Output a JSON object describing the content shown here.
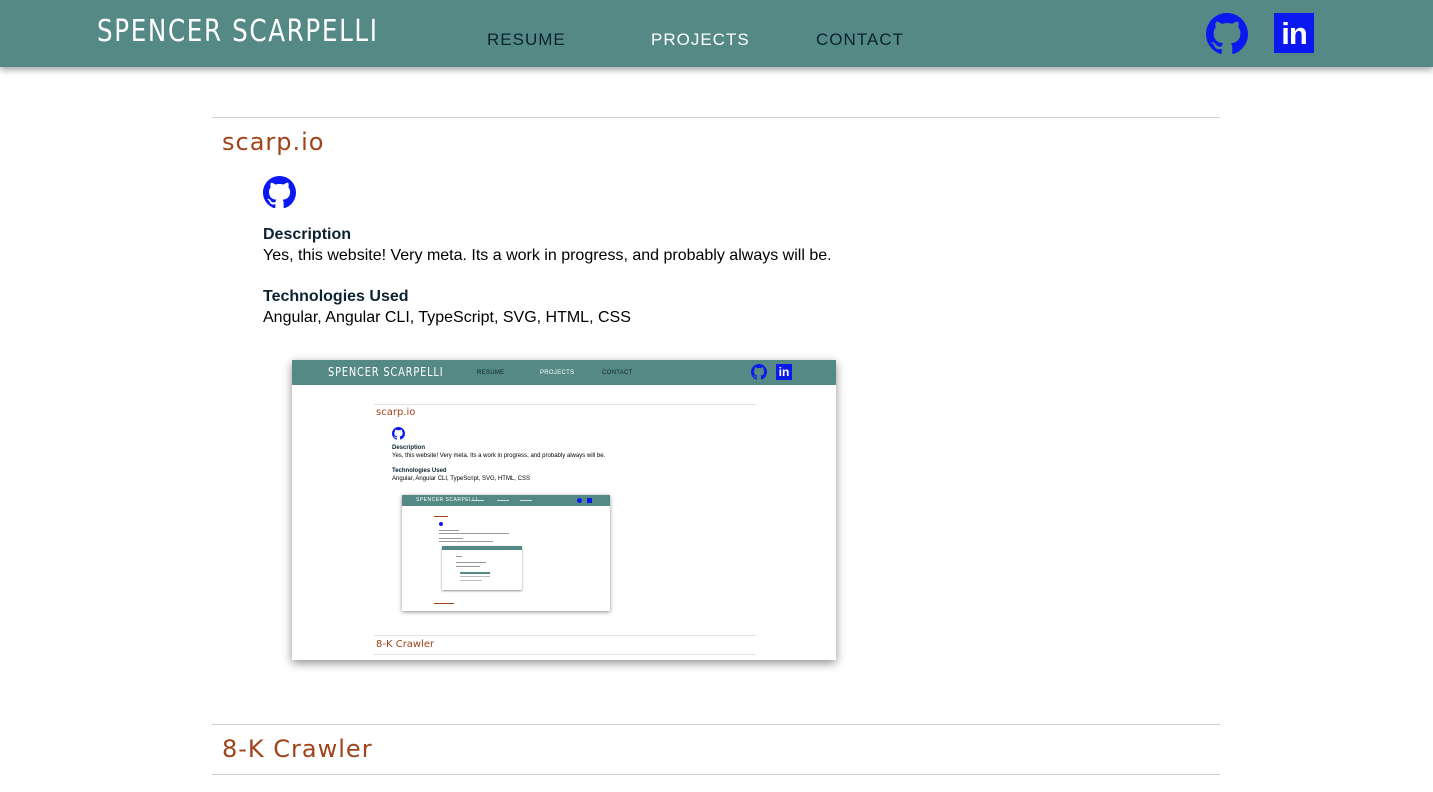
{
  "header": {
    "brand": "SPENCER SCARPELLI",
    "nav": [
      {
        "label": "RESUME",
        "active": false
      },
      {
        "label": "PROJECTS",
        "active": true
      },
      {
        "label": "CONTACT",
        "active": false
      }
    ],
    "social": {
      "github_icon": "github-icon",
      "linkedin_text": "in"
    }
  },
  "projects": [
    {
      "title": "scarp.io",
      "expanded": true,
      "description_label": "Description",
      "description": "Yes, this website! Very meta. Its a work in progress, and probably always will be.",
      "tech_label": "Technologies Used",
      "tech": "Angular, Angular CLI, TypeScript, SVG, HTML, CSS",
      "screenshot": {
        "brand": "SPENCER SCARPELLI",
        "nav": [
          "RESUME",
          "PROJECTS",
          "CONTACT"
        ],
        "project_title": "scarp.io",
        "description_label": "Description",
        "description": "Yes, this website! Very meta. Its a work in progress, and probably always will be.",
        "tech_label": "Technologies Used",
        "tech": "Angular, Angular CLI, TypeScript, SVG, HTML, CSS",
        "next_title": "8-K Crawler",
        "inner_brand": "SPENCER SCARPELLI"
      }
    },
    {
      "title": "8-K Crawler",
      "expanded": false
    }
  ],
  "colors": {
    "header_bg": "#558985",
    "accent": "#a0431a",
    "icon_blue": "#0b18f0",
    "nav_text": "#0b2231"
  }
}
